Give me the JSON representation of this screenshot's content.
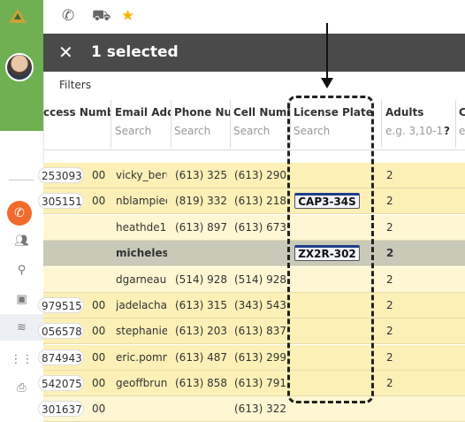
{
  "toolbar": {
    "phone_icon": "phone-icon",
    "car_icon": "car-icon",
    "star_icon": "star-icon"
  },
  "selection_bar": {
    "close_label": "✕",
    "text": "1 selected"
  },
  "filters_label": "Filters",
  "columns": [
    {
      "header": "ccess Numbe",
      "search": ""
    },
    {
      "header": "Email Addr",
      "search": "Search"
    },
    {
      "header": "Phone Num",
      "search": "Search"
    },
    {
      "header": "Cell Numbe",
      "search": "Search"
    },
    {
      "header": "License Plate",
      "search": "Search"
    },
    {
      "header": "Adults",
      "search": "e.g. 3,10-1",
      "help": "?"
    },
    {
      "header": "C",
      "search": "e"
    }
  ],
  "rows": [
    {
      "access": "253093",
      "code": "00",
      "email": "vicky_beru",
      "phone": "(613) 325",
      "cell": "(613) 290",
      "plate": "",
      "adults": "2",
      "bold": false
    },
    {
      "access": "305151",
      "code": "00",
      "email": "nblampiec",
      "phone": "(819) 332",
      "cell": "(613) 218",
      "plate": "CAP3-34S",
      "adults": "2",
      "bold": false
    },
    {
      "access": "",
      "code": "",
      "email": "heathde1c",
      "phone": "(613) 897",
      "cell": "(613) 673",
      "plate": "",
      "adults": "2",
      "bold": false
    },
    {
      "access": "",
      "code": "",
      "email": "michelesi",
      "phone": "",
      "cell": "",
      "plate": "ZX2R-302",
      "adults": "2",
      "bold": true
    },
    {
      "access": "",
      "code": "",
      "email": "dgarneau",
      "phone": "(514) 928",
      "cell": "(514) 928",
      "plate": "",
      "adults": "2",
      "bold": false
    },
    {
      "access": "979515",
      "code": "00",
      "email": "jadelacha",
      "phone": "(613) 315",
      "cell": "(343) 543",
      "plate": "",
      "adults": "2",
      "bold": false
    },
    {
      "access": "056578",
      "code": "00",
      "email": "stephanie",
      "phone": "(613) 203",
      "cell": "(613) 837",
      "plate": "",
      "adults": "2",
      "bold": false
    },
    {
      "access": "874943",
      "code": "00",
      "email": "eric.pomm",
      "phone": "(613) 487",
      "cell": "(613) 299",
      "plate": "",
      "adults": "2",
      "bold": false
    },
    {
      "access": "542075",
      "code": "00",
      "email": "geoffbrun",
      "phone": "(613) 858",
      "cell": "(613) 791",
      "plate": "",
      "adults": "2",
      "bold": false
    },
    {
      "access": "301637",
      "code": "00",
      "email": "",
      "phone": "",
      "cell": "(613) 322",
      "plate": "",
      "adults": "",
      "bold": false
    }
  ],
  "colors": {
    "accent": "#6fb152",
    "selection_bar": "#4a4a4a",
    "row_highlight": "#fcf0b6",
    "selected_row": "#c9c9b8",
    "phone_button": "#f06b2c"
  }
}
